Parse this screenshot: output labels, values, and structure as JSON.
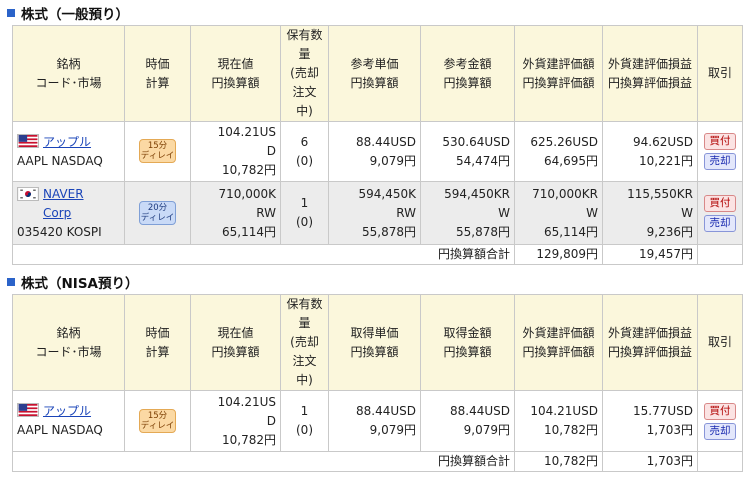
{
  "sections": [
    {
      "title": "株式（一般預り）",
      "headers": [
        "銘柄\nコード･市場",
        "時価\n計算",
        "現在値\n円換算額",
        "保有数\n量\n(売却\n注文\n中)",
        "参考単価\n円換算額",
        "参考金額\n円換算額",
        "外貨建評価額\n円換算評価額",
        "外貨建評価損益\n円換算評価損益",
        "取引"
      ],
      "rows": [
        {
          "flag": "us",
          "name": "アップル",
          "code_market": "AAPL NASDAQ",
          "delay": "15分\nディレイ",
          "price": "104.21US\nD\n10,782円",
          "qty": "6\n(0)",
          "unit": "88.44USD\n9,079円",
          "amount": "530.64USD\n54,474円",
          "eval": "625.26USD\n64,695円",
          "pl": "94.62USD\n10,221円",
          "buy": "買付",
          "sell": "売却"
        },
        {
          "flag": "kr",
          "name": "NAVER\nCorp",
          "code_market": "035420 KOSPI",
          "delay": "20分\nディレイ",
          "price": "710,000K\nRW\n65,114円",
          "qty": "1\n(0)",
          "unit": "594,450K\nRW\n55,878円",
          "amount": "594,450KR\nW\n55,878円",
          "eval": "710,000KR\nW\n65,114円",
          "pl": "115,550KR\nW\n9,236円",
          "buy": "買付",
          "sell": "売却"
        }
      ],
      "total_label": "円換算額合計",
      "total_eval": "129,809円",
      "total_pl": "19,457円"
    },
    {
      "title": "株式（NISA預り）",
      "headers": [
        "銘柄\nコード･市場",
        "時価\n計算",
        "現在値\n円換算額",
        "保有数\n量\n(売却\n注文\n中)",
        "取得単価\n円換算額",
        "取得金額\n円換算額",
        "外貨建評価額\n円換算評価額",
        "外貨建評価損益\n円換算評価損益",
        "取引"
      ],
      "rows": [
        {
          "flag": "us",
          "name": "アップル",
          "code_market": "AAPL NASDAQ",
          "delay": "15分\nディレイ",
          "price": "104.21US\nD\n10,782円",
          "qty": "1\n(0)",
          "unit": "88.44USD\n9,079円",
          "amount": "88.44USD\n9,079円",
          "eval": "104.21USD\n10,782円",
          "pl": "15.77USD\n1,703円",
          "buy": "買付",
          "sell": "売却"
        }
      ],
      "total_label": "円換算額合計",
      "total_eval": "10,782円",
      "total_pl": "1,703円"
    }
  ],
  "colors": {
    "header_bg": "#fbf7dc",
    "link": "#1a44b8",
    "bullet": "#2b63c9",
    "delay15": "#fbd9a4",
    "delay20": "#c9daf7",
    "buy": "#b00000",
    "sell": "#1a2bb0"
  }
}
